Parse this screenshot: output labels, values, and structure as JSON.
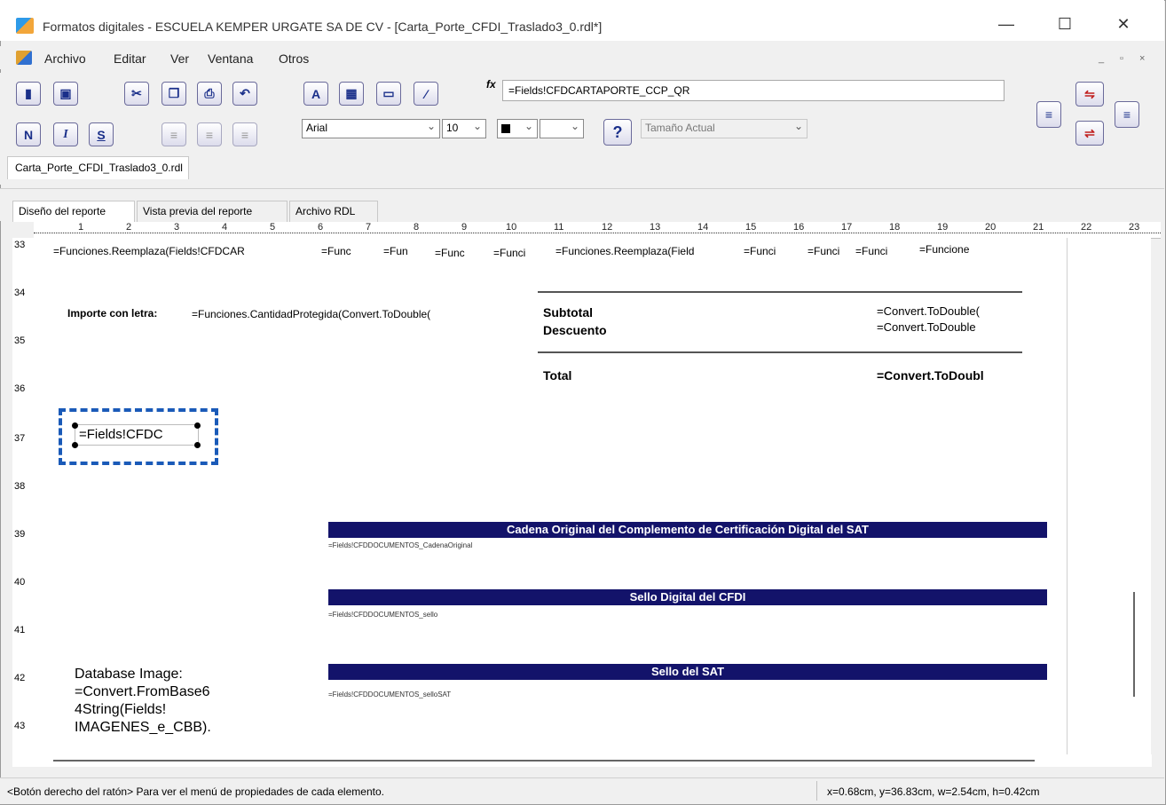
{
  "window": {
    "title": "Formatos digitales - ESCUELA KEMPER URGATE SA DE CV - [Carta_Porte_CFDI_Traslado3_0.rdl*]",
    "minimize": "—",
    "maximize": "☐",
    "close": "✕"
  },
  "menu": {
    "items": [
      "Archivo",
      "Editar",
      "Ver",
      "Ventana",
      "Otros"
    ],
    "mdi_buttons": [
      "_",
      "▫",
      "×"
    ]
  },
  "toolbar": {
    "bold": "N",
    "italic": "I",
    "underline": "S",
    "fx_label": "fx",
    "formula": "=Fields!CFDCARTAPORTE_CCP_QR",
    "font": "Arial",
    "font_size": "10",
    "zoom": "Tamaño Actual",
    "help": "?"
  },
  "file_tab": "Carta_Porte_CFDI_Traslado3_0.rdl",
  "view_tabs": [
    "Diseño del reporte",
    "Vista previa del reporte",
    "Archivo RDL"
  ],
  "ruler": {
    "horizontal": [
      "1",
      "2",
      "3",
      "4",
      "5",
      "6",
      "7",
      "8",
      "9",
      "10",
      "11",
      "12",
      "13",
      "14",
      "15",
      "16",
      "17",
      "18",
      "19",
      "20",
      "21",
      "22",
      "23"
    ],
    "vertical": [
      "33",
      "34",
      "35",
      "36",
      "37",
      "38",
      "39",
      "40",
      "41",
      "42",
      "43"
    ]
  },
  "report": {
    "row_fields": [
      "=Funciones.Reemplaza(Fields!CFDCAR",
      "=Func",
      "=Fun",
      "=Func",
      "=Funci",
      "=Funciones.Reemplaza(Field",
      "=Funci",
      "=Funci",
      "=Funci",
      "=Funcione"
    ],
    "importe_label": "Importe con letra:",
    "importe_value": "=Funciones.CantidadProtegida(Convert.ToDouble(",
    "subtotal_label": "Subtotal",
    "descuento_label": "Descuento",
    "subtotal_value": "=Convert.ToDouble(",
    "descuento_value": "=Convert.ToDouble",
    "total_label": "Total",
    "total_value": "=Convert.ToDoubl",
    "selected_field": "=Fields!CFDC",
    "cadena_title": "Cadena Original del Complemento de Certificación Digital del SAT",
    "cadena_field": "=Fields!CFDDOCUMENTOS_CadenaOriginal",
    "sello_cfdi_title": "Sello Digital del CFDI",
    "sello_cfdi_field": "=Fields!CFDDOCUMENTOS_sello",
    "sello_sat_title": "Sello del SAT",
    "sello_sat_field": "=Fields!CFDDOCUMENTOS_selloSAT",
    "db_image_lines": [
      "Database Image:",
      "=Convert.FromBase6",
      "4String(Fields!",
      "IMAGENES_e_CBB)."
    ]
  },
  "status": {
    "hint": "<Botón derecho del ratón> Para ver el menú de propiedades de cada elemento.",
    "coords": "x=0.68cm, y=36.83cm, w=2.54cm, h=0.42cm"
  }
}
